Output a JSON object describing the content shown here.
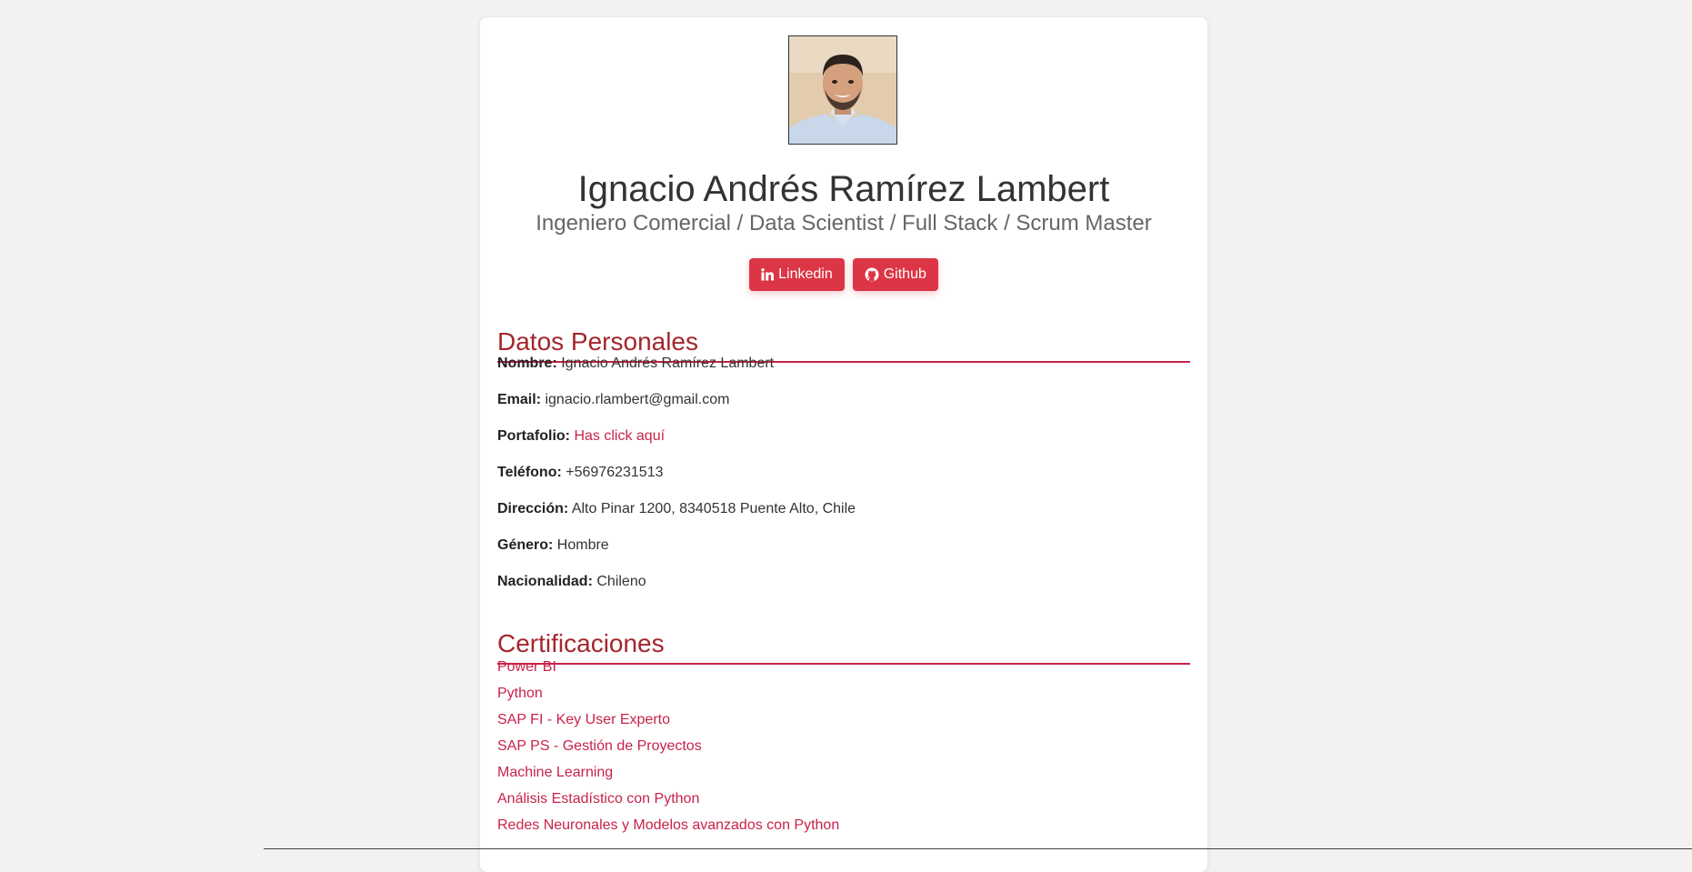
{
  "profile": {
    "name": "Ignacio Andrés Ramírez Lambert",
    "subtitle": "Ingeniero Comercial / Data Scientist / Full Stack / Scrum Master"
  },
  "buttons": {
    "linkedin": {
      "label": "Linkedin",
      "icon": "linkedin-icon"
    },
    "github": {
      "label": "Github",
      "icon": "github-icon"
    }
  },
  "personal": {
    "title": "Datos Personales",
    "items": [
      {
        "key": "Nombre:",
        "value": "Ignacio Andrés Ramírez Lambert"
      },
      {
        "key": "Email:",
        "value": "ignacio.rlambert@gmail.com"
      },
      {
        "key": "Portafolio:",
        "value": "Has click aquí",
        "link": true
      },
      {
        "key": "Teléfono:",
        "value": "+56976231513"
      },
      {
        "key": "Dirección:",
        "value": "Alto Pinar 1200, 8340518 Puente Alto, Chile"
      },
      {
        "key": "Género:",
        "value": "Hombre"
      },
      {
        "key": "Nacionalidad:",
        "value": "Chileno"
      }
    ]
  },
  "certifications": {
    "title": "Certificaciones",
    "items": [
      "Power BI",
      "Python",
      "SAP FI - Key User Experto",
      "SAP PS - Gestión de Proyectos",
      "Machine Learning",
      "Análisis Estadístico con Python",
      "Redes Neuronales y Modelos avanzados con Python"
    ]
  },
  "colors": {
    "accent": "#dc3545",
    "link": "#c8234a",
    "heading": "#a4262c",
    "background": "#f2f2f2"
  }
}
